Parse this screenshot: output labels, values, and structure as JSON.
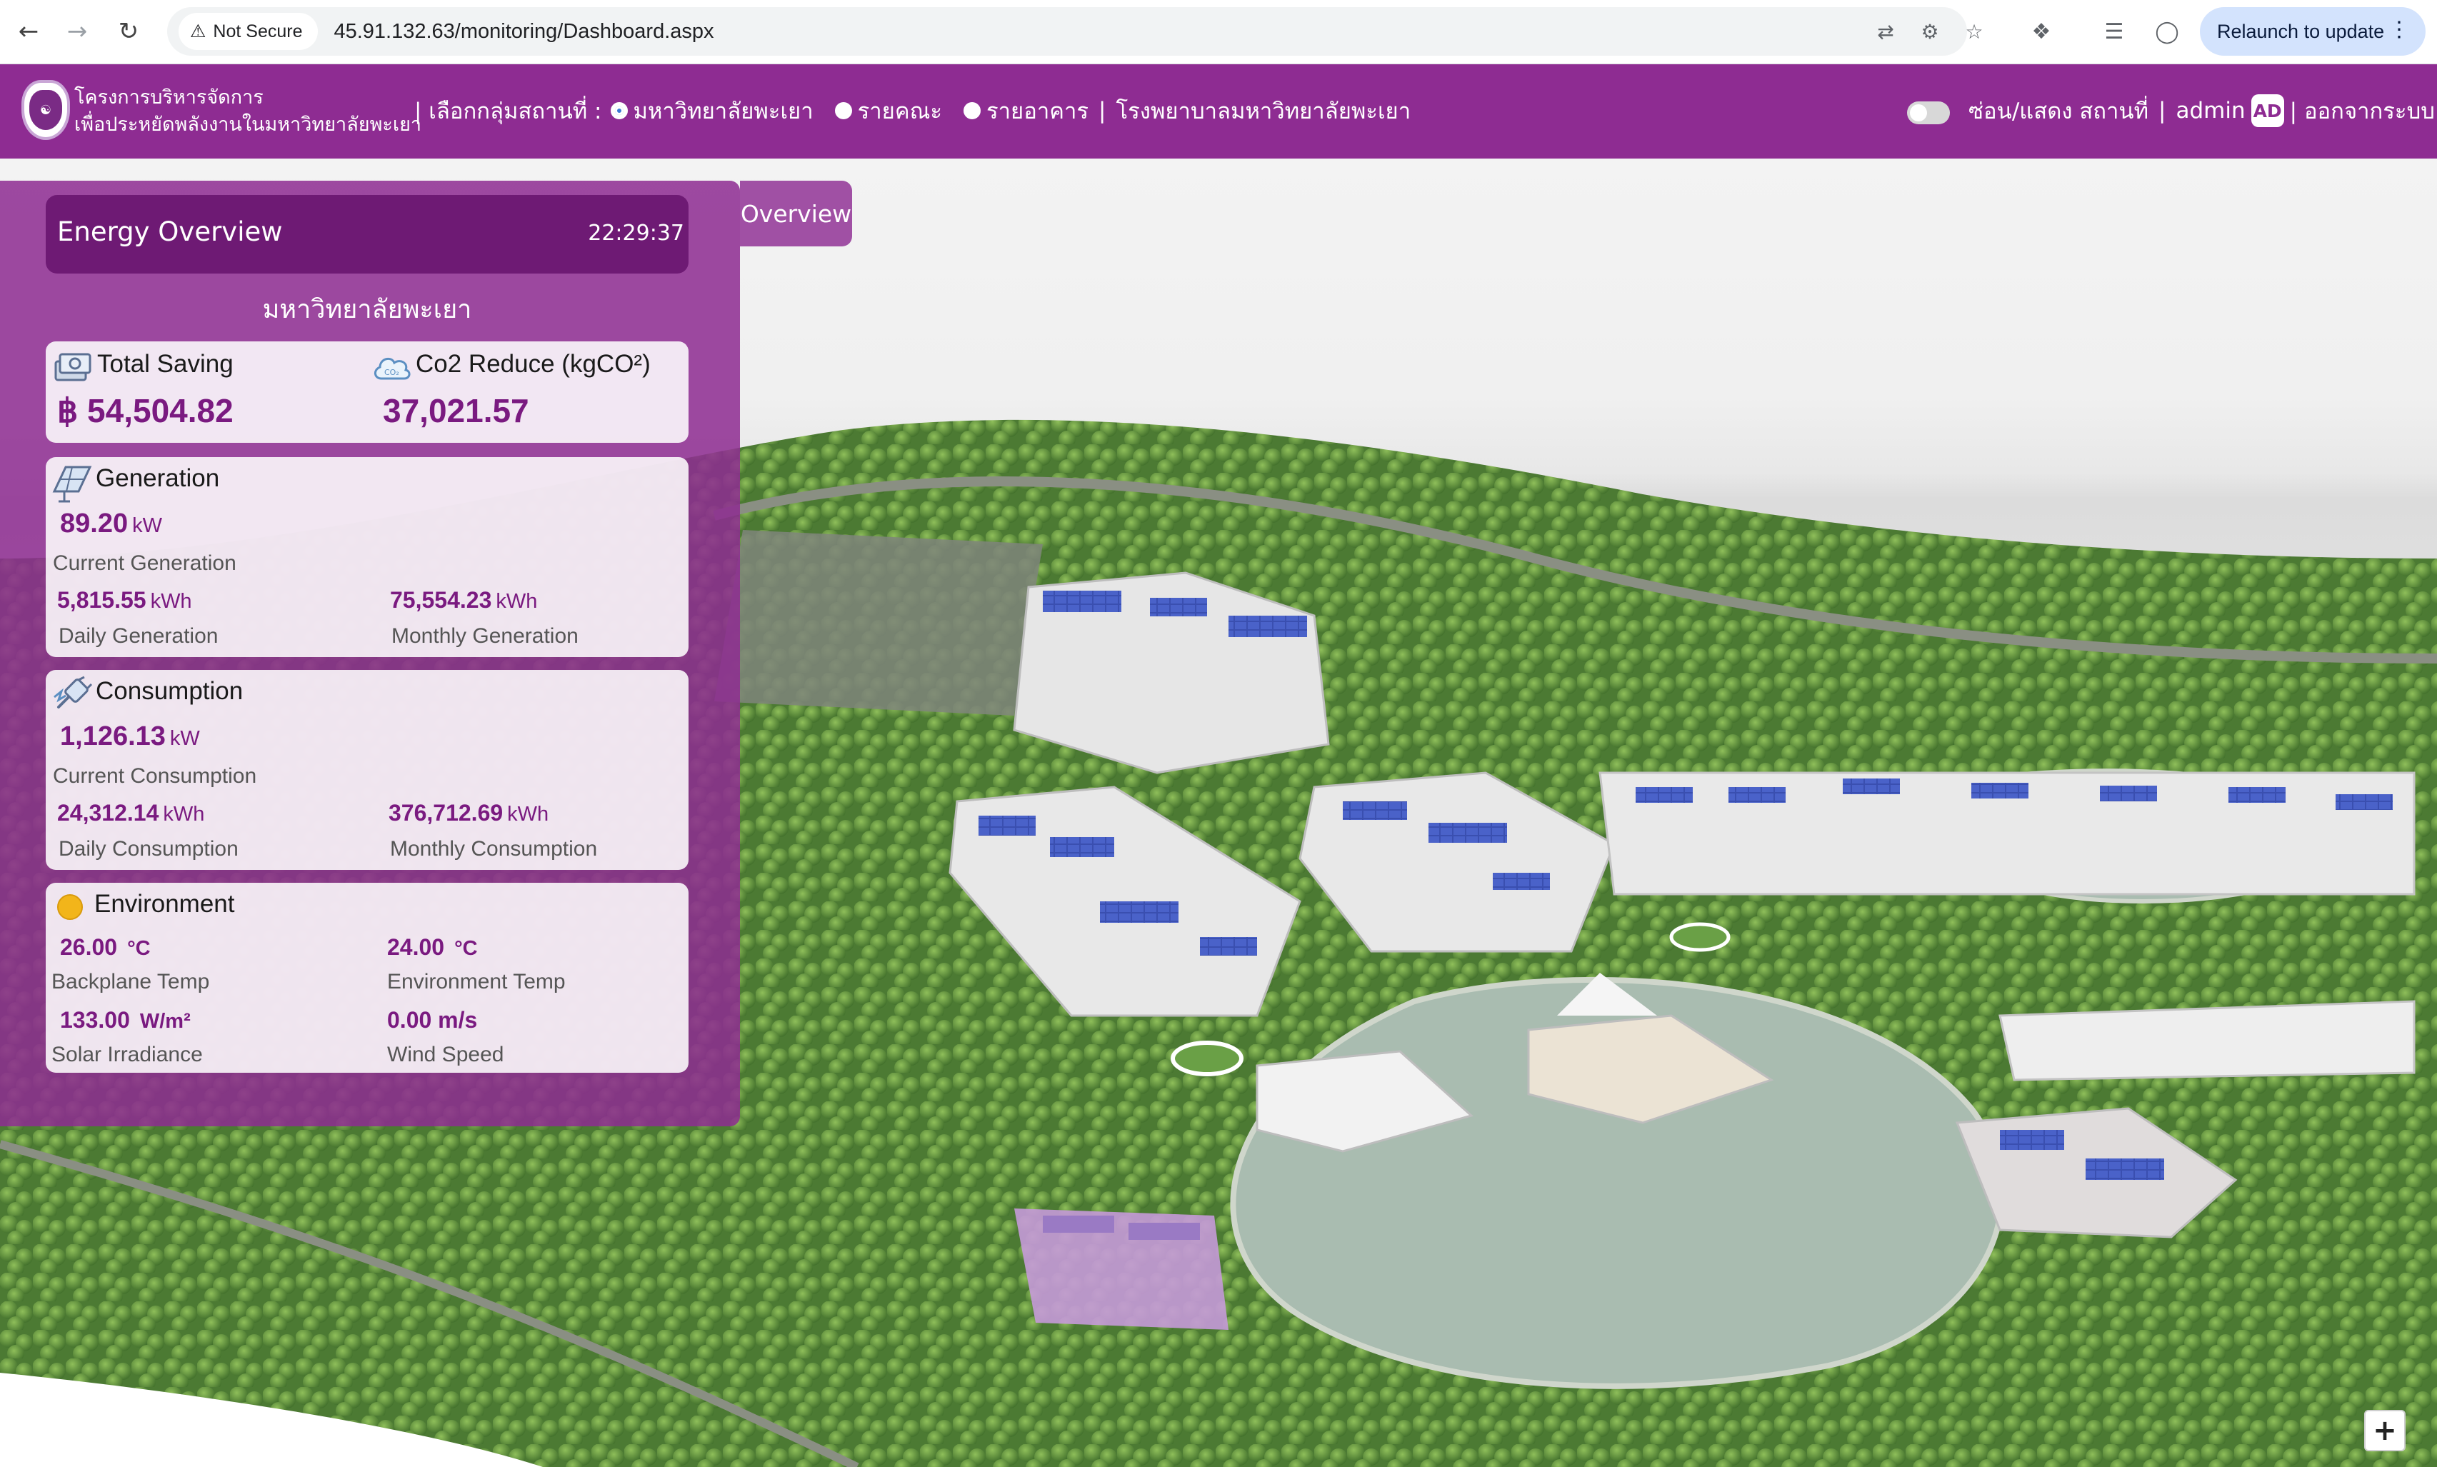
{
  "browser": {
    "security_label": "Not Secure",
    "url": "45.91.132.63/monitoring/Dashboard.aspx",
    "relaunch_label": "Relaunch to update"
  },
  "header": {
    "org_line1": "โครงการบริหารจัดการ",
    "org_line2": "เพื่อประหยัดพลังงานในมหาวิทยาลัยพะเยา",
    "group_label": "| เลือกกลุ่มสถานที่ :",
    "options": [
      "มหาวิทยาลัยพะเยา",
      "รายคณะ",
      "รายอาคาร"
    ],
    "selected_option": "มหาวิทยาลัยพะเยา",
    "separator": "|",
    "hospital_link": "โรงพยาบาลมหาวิทยาลัยพะเยา",
    "toggle_label": "ซ่อน/แสดง สถานที่",
    "user_sep": "|",
    "username": "admin",
    "avatar_initials": "AD",
    "logout_label": "| ออกจากระบบ"
  },
  "panel": {
    "tab_label": "Overview",
    "title": "Energy Overview",
    "time": "22:29:37",
    "site_name": "มหาวิทยาลัยพะเยา",
    "saving": {
      "title": "Total Saving",
      "value": "฿ 54,504.82",
      "co2_title": "Co2 Reduce (kgCO²)",
      "co2_value": "37,021.57"
    },
    "generation": {
      "title": "Generation",
      "current_value": "89.20",
      "current_unit": "kW",
      "current_caption": "Current Generation",
      "daily_value": "5,815.55",
      "daily_unit": "kWh",
      "daily_caption": "Daily Generation",
      "monthly_value": "75,554.23",
      "monthly_unit": "kWh",
      "monthly_caption": "Monthly Generation"
    },
    "consumption": {
      "title": "Consumption",
      "current_value": "1,126.13",
      "current_unit": "kW",
      "current_caption": "Current Consumption",
      "daily_value": "24,312.14",
      "daily_unit": "kWh",
      "daily_caption": "Daily Consumption",
      "monthly_value": "376,712.69",
      "monthly_unit": "kWh",
      "monthly_caption": "Monthly Consumption"
    },
    "environment": {
      "title": "Environment",
      "backplane_value": "26.00",
      "backplane_unit": "°C",
      "backplane_caption": "Backplane Temp",
      "env_value": "24.00",
      "env_unit": "°C",
      "env_caption": "Environment Temp",
      "irradiance_value": "133.00",
      "irradiance_unit": "W/m²",
      "irradiance_caption": "Solar Irradiance",
      "wind_value": "0.00 m/s",
      "wind_caption": "Wind Speed"
    }
  },
  "map": {
    "zoom_in_label": "+"
  },
  "colors": {
    "brand_purple": "#8e2c92",
    "header_dark": "#6e1a74",
    "value_purple": "#7a1a80",
    "sun_yellow": "#f2b51a"
  }
}
